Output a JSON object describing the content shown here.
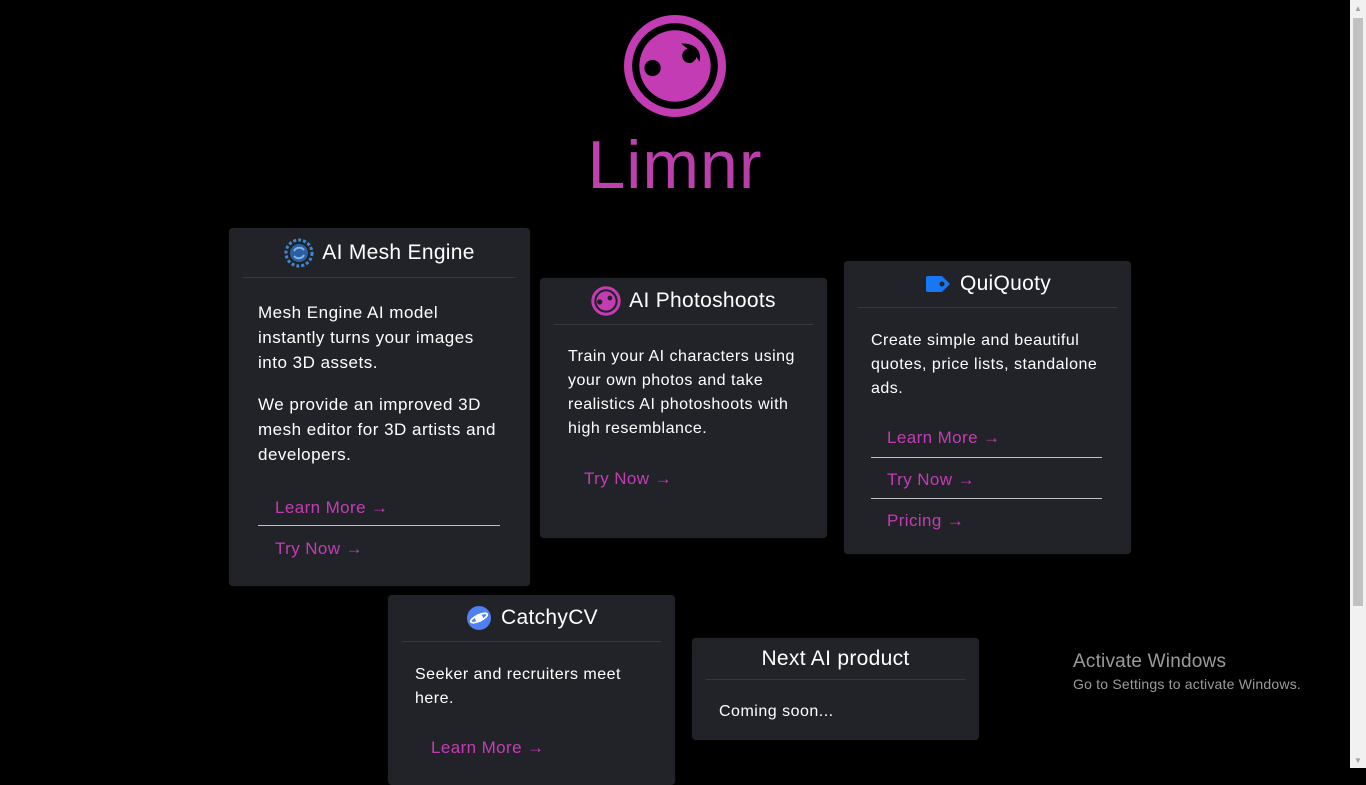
{
  "brand": {
    "name": "Limnr",
    "color": "#c43cb4"
  },
  "cards": {
    "mesh": {
      "title": "AI Mesh Engine",
      "icon": "gear-swirl-icon",
      "paragraphs": [
        "Mesh Engine AI model instantly turns your images into 3D assets.",
        "We provide an improved 3D mesh editor for 3D artists and developers."
      ],
      "links": [
        "Learn More →",
        "Try Now →"
      ]
    },
    "photo": {
      "title": "AI Photoshoots",
      "icon": "limnr-logo-icon",
      "paragraphs": [
        "Train your AI characters using your own photos and take realistics AI photoshoots with high resemblance."
      ],
      "links": [
        "Try Now →"
      ]
    },
    "quiquoty": {
      "title": "QuiQuoty",
      "icon": "price-tag-icon",
      "paragraphs": [
        "Create simple and beautiful quotes, price lists, standalone ads."
      ],
      "links": [
        "Learn More →",
        "Try Now →",
        "Pricing →"
      ]
    },
    "catchy": {
      "title": "CatchyCV",
      "icon": "planet-icon",
      "paragraphs": [
        "Seeker and recruiters meet here."
      ],
      "links": [
        "Learn More →"
      ]
    },
    "next": {
      "title": "Next AI product",
      "paragraphs": [
        "Coming soon..."
      ]
    }
  },
  "watermark": {
    "title": "Activate Windows",
    "subtitle": "Go to Settings to activate Windows."
  },
  "colors": {
    "background": "#000000",
    "card": "#212328",
    "accent": "#c43cb4",
    "quiquoty_icon": "#1877f2",
    "mesh_icon": "#3f87d4",
    "catchy_icon": "#4f7ff0"
  }
}
